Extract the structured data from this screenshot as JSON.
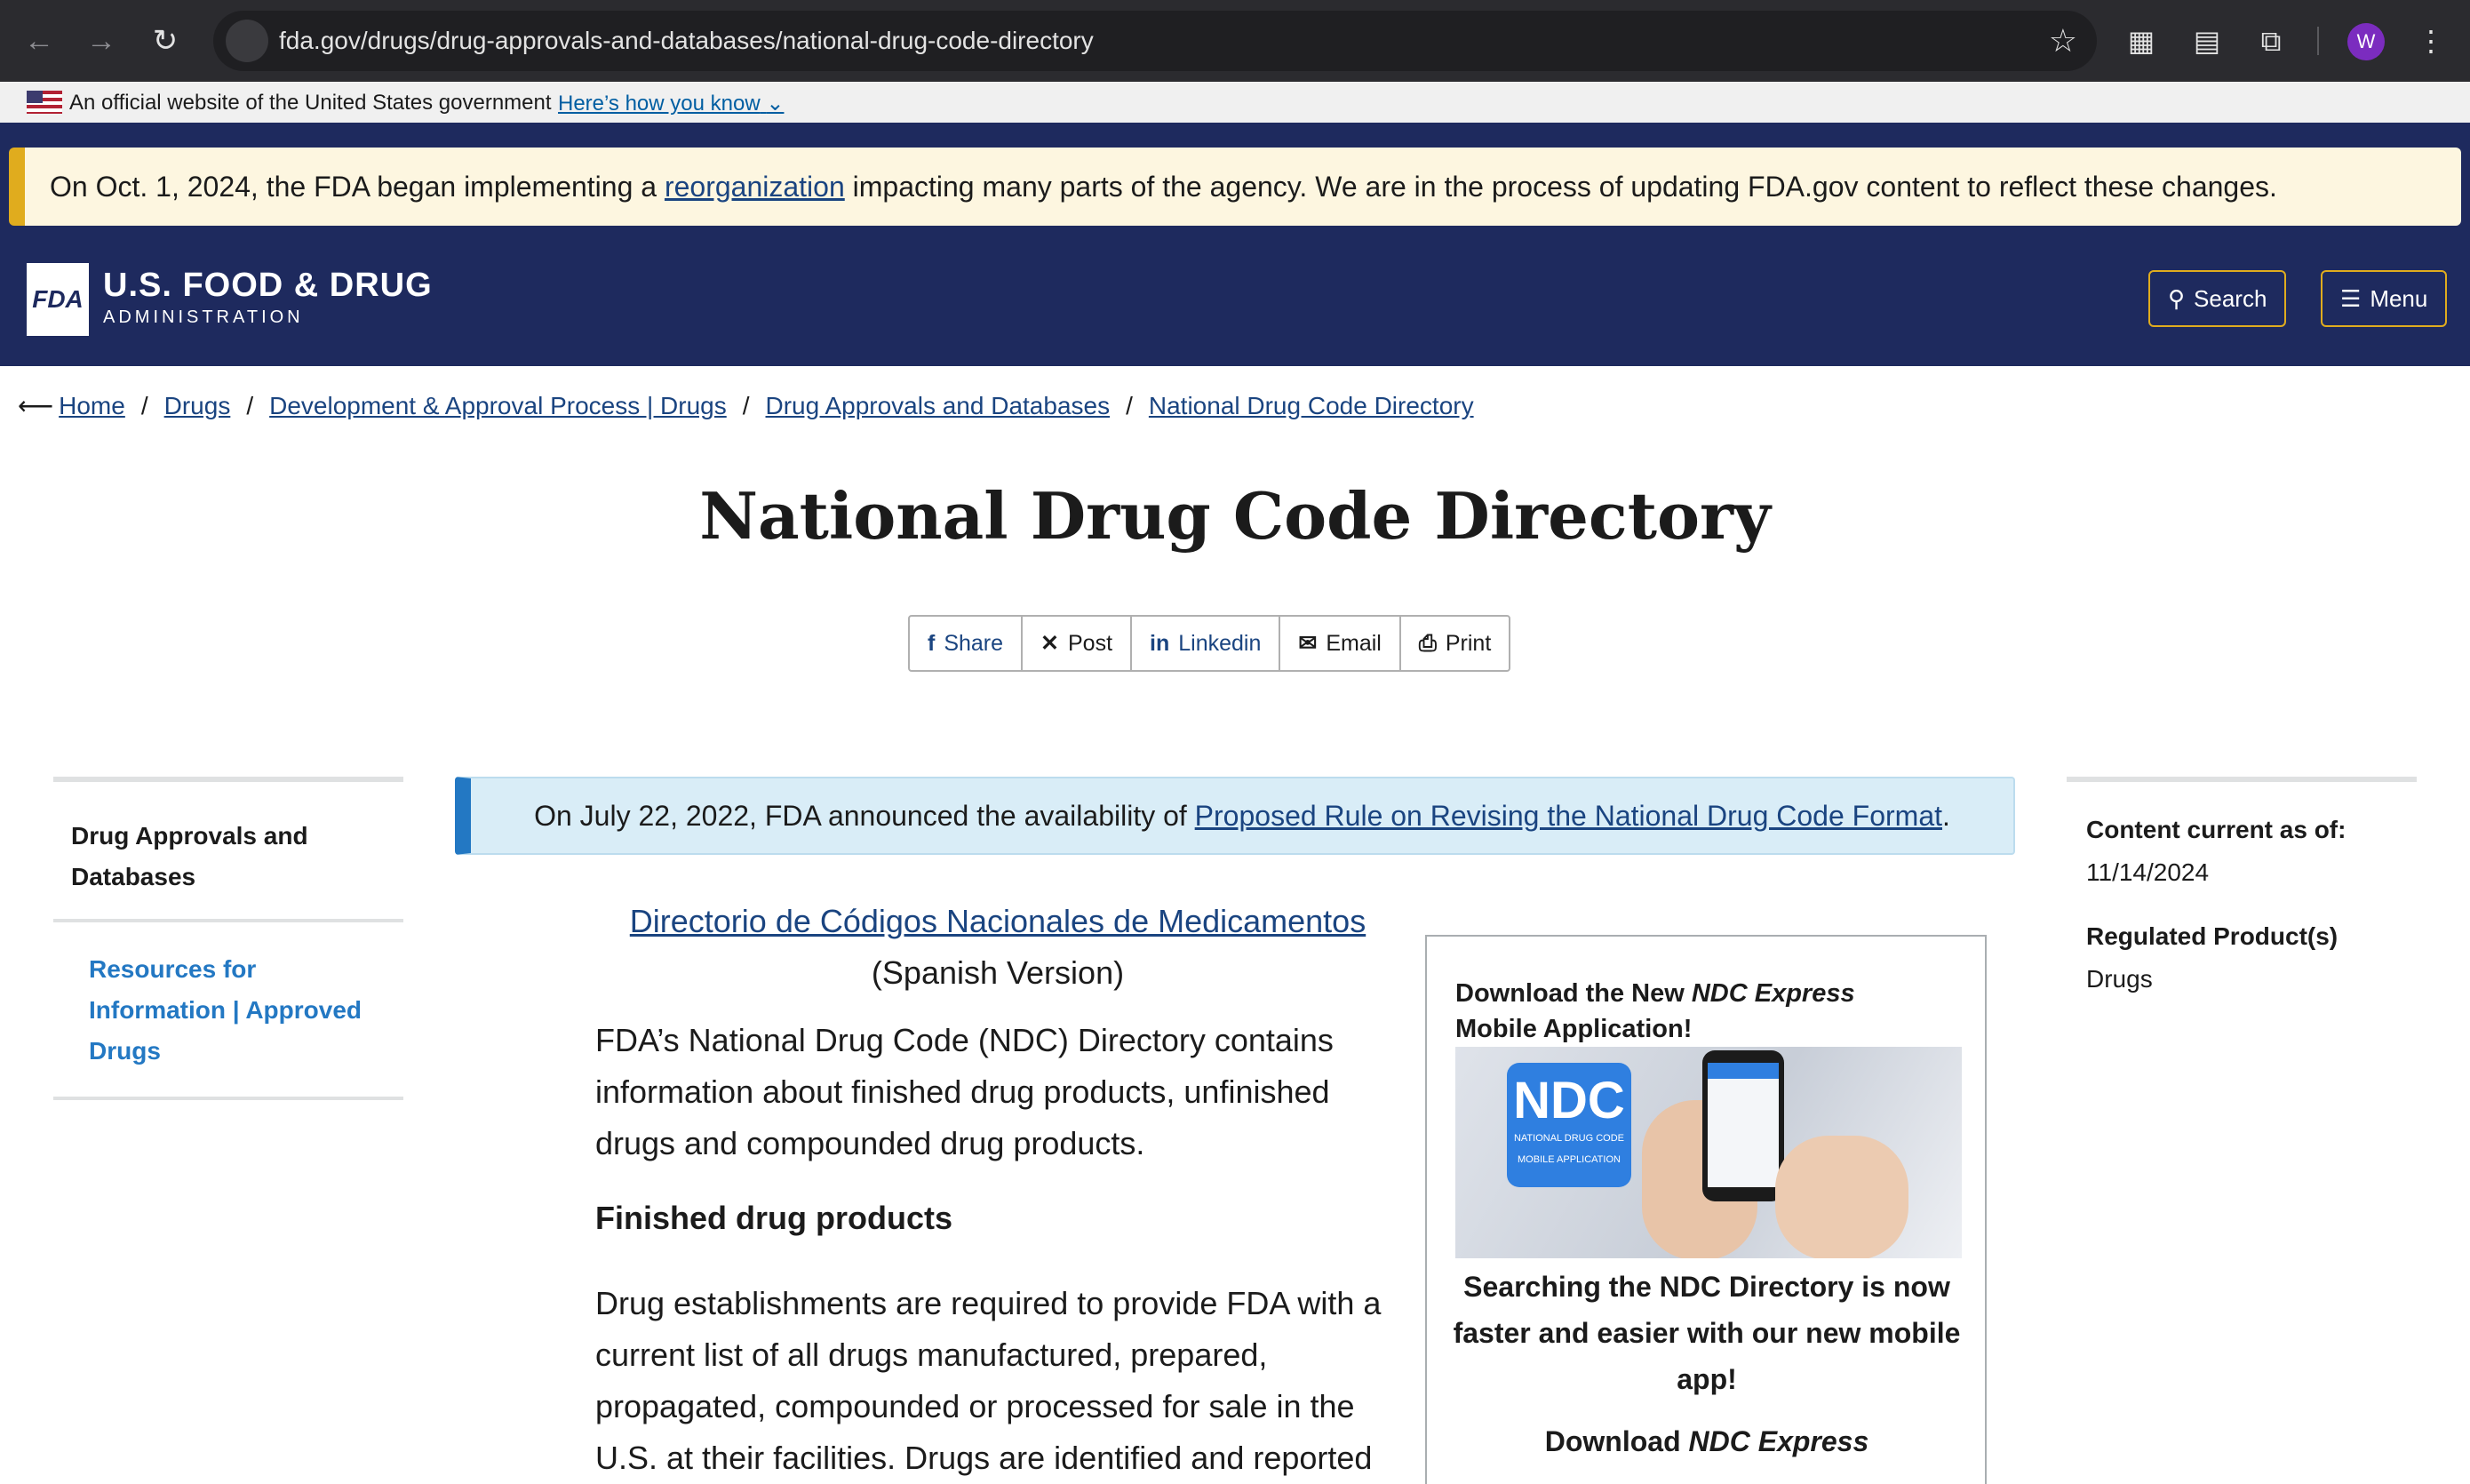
{
  "browser": {
    "url": "fda.gov/drugs/drug-approvals-and-databases/national-drug-code-directory",
    "profile_initial": "W"
  },
  "gov_banner": {
    "text": "An official website of the United States government",
    "link": "Here’s how you know"
  },
  "alert": {
    "before": "On Oct. 1, 2024, the FDA began implementing a ",
    "link": "reorganization",
    "after": " impacting many parts of the agency. We are in the process of updating FDA.gov content to reflect these changes.",
    "accent_color": "#e0ac1e"
  },
  "header": {
    "logo_mark": "FDA",
    "title": "U.S. FOOD & DRUG",
    "subtitle": "ADMINISTRATION",
    "search_label": "Search",
    "menu_label": "Menu",
    "background_color": "#1e2a5e"
  },
  "breadcrumb": [
    "Home",
    "Drugs",
    "Development & Approval Process | Drugs",
    "Drug Approvals and Databases",
    "National Drug Code Directory"
  ],
  "page_title": "National Drug Code Directory",
  "share": {
    "share": "Share",
    "post": "Post",
    "linkedin": "Linkedin",
    "email": "Email",
    "print": "Print"
  },
  "sidebar": {
    "parent": "Drug Approvals and Databases",
    "child": "Resources for Information | Approved Drugs"
  },
  "notice": {
    "before": "On July 22, 2022, FDA announced the availability of ",
    "link": "Proposed Rule on Revising the National Drug Code Format",
    "after": "."
  },
  "main": {
    "spanish_link": "Directorio de Códigos Nacionales de Medicamentos",
    "spanish_note": "(Spanish Version)",
    "intro": "FDA’s National Drug Code (NDC) Directory contains information about finished drug products, unfinished drugs and compounded drug products.",
    "heading_finished": "Finished drug products",
    "finished_text": "Drug establishments are required to provide FDA with a current list of all drugs manufactured, prepared, propagated, compounded or processed for sale in the U.S. at their facilities. Drugs are identified and reported"
  },
  "promo": {
    "title_before": "Download the New ",
    "title_em": "NDC Express",
    "title_after": "Mobile Application!",
    "tile_big": "NDC",
    "tile_small1": "NATIONAL DRUG CODE",
    "tile_small2": "MOBILE APPLICATION",
    "caption": "Searching the NDC Directory is now faster and easier with our new mobile app!",
    "download_before": "Download ",
    "download_em": "NDC Express"
  },
  "rail": {
    "content_label": "Content current as of:",
    "content_date": "11/14/2024",
    "regulated_label": "Regulated Product(s)",
    "regulated_value": "Drugs"
  }
}
